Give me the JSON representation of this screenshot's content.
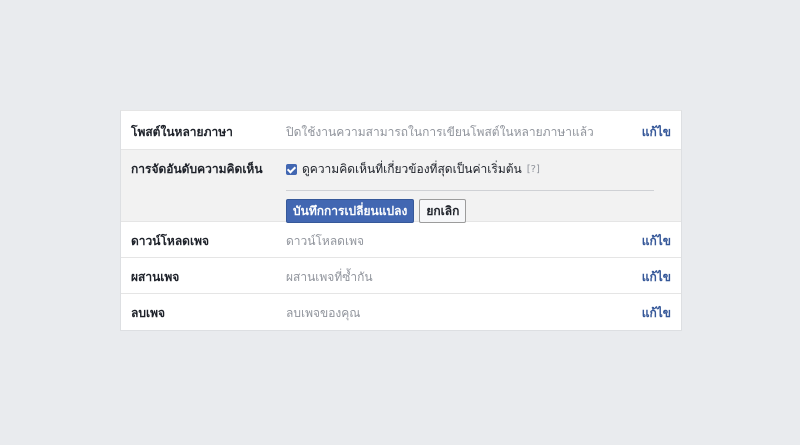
{
  "settings": {
    "rows": [
      {
        "label": "โพสต์ในหลายภาษา",
        "value": "ปิดใช้งานความสามารถในการเขียนโพสต์ในหลายภาษาแล้ว",
        "edit": "แก้ไข"
      },
      {
        "label": "การจัดอันดับความคิดเห็น",
        "checkbox_label": "ดูความคิดเห็นที่เกี่ยวข้องที่สุดเป็นค่าเริ่มต้น",
        "checkbox_checked": true,
        "help": "[?]",
        "save_label": "บันทึกการเปลี่ยนแปลง",
        "cancel_label": "ยกเลิก"
      },
      {
        "label": "ดาวน์โหลดเพจ",
        "value": "ดาวน์โหลดเพจ",
        "edit": "แก้ไข"
      },
      {
        "label": "ผสานเพจ",
        "value": "ผสานเพจที่ซ้ำกัน",
        "edit": "แก้ไข"
      },
      {
        "label": "ลบเพจ",
        "value": "ลบเพจของคุณ",
        "edit": "แก้ไข"
      }
    ]
  },
  "colors": {
    "link": "#365899",
    "primary_button": "#4267b2",
    "page_background": "#e9ebee"
  }
}
